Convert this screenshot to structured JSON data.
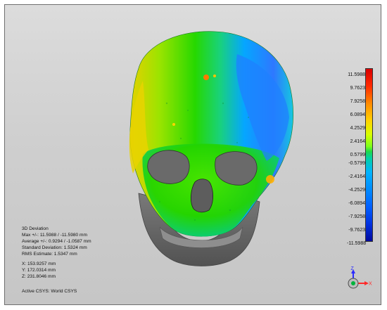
{
  "legend": {
    "ticks": [
      "11.5988",
      "9.7623",
      "7.9258",
      "6.0894",
      "4.2529",
      "2.4164",
      "0.5799",
      "-0.5799",
      "-2.4164",
      "-4.2529",
      "-6.0894",
      "-7.9258",
      "-9.7623",
      "-11.5988"
    ]
  },
  "info": {
    "title": "3D Deviation",
    "max": "Max +/-: 11.5988 / -11.5980 mm",
    "average": "Average +/-: 0.9294 / -1.0587 mm",
    "std": "Standard Deviation: 1.5324 mm",
    "rms": "RMS Estimate: 1.5347 mm",
    "x": "X:  153.9257 mm",
    "y": "Y:  172.0314 mm",
    "z": "Z:  231.8046 mm",
    "csys": "Active CSYS: World CSYS"
  },
  "triad": {
    "z_label": "Z",
    "x_label": "X"
  },
  "colors": {
    "accent_red": "#d80000",
    "accent_blue": "#000a9e"
  }
}
